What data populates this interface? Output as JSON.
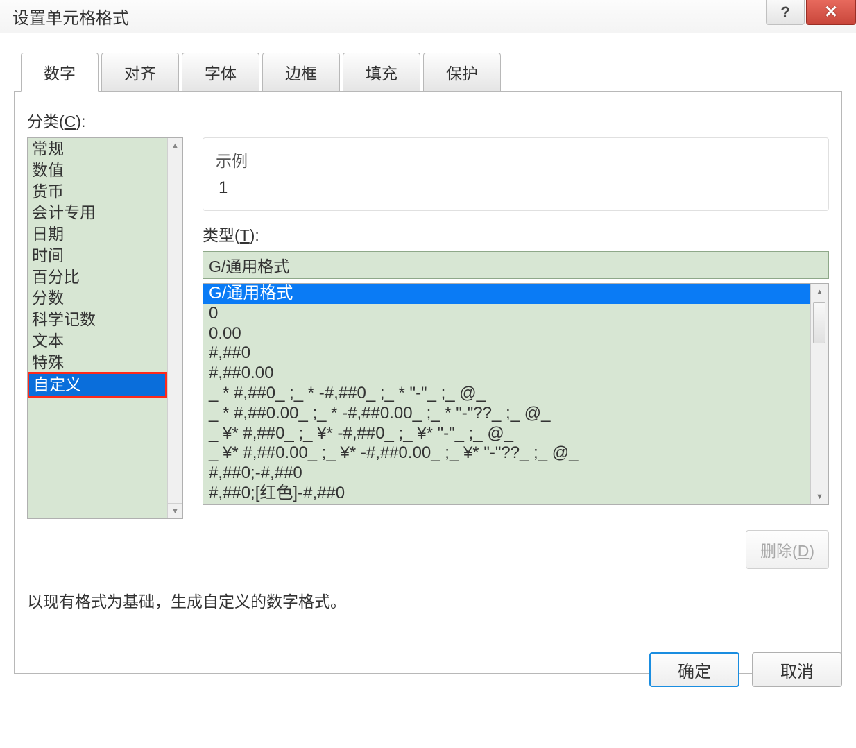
{
  "window": {
    "title": "设置单元格格式"
  },
  "tabs": [
    {
      "label": "数字",
      "active": true
    },
    {
      "label": "对齐",
      "active": false
    },
    {
      "label": "字体",
      "active": false
    },
    {
      "label": "边框",
      "active": false
    },
    {
      "label": "填充",
      "active": false
    },
    {
      "label": "保护",
      "active": false
    }
  ],
  "category": {
    "label_prefix": "分类(",
    "label_key": "C",
    "label_suffix": "):",
    "items": [
      "常规",
      "数值",
      "货币",
      "会计专用",
      "日期",
      "时间",
      "百分比",
      "分数",
      "科学记数",
      "文本",
      "特殊",
      "自定义"
    ],
    "selected_index": 11
  },
  "example": {
    "label": "示例",
    "value": "1"
  },
  "type": {
    "label_prefix": "类型(",
    "label_key": "T",
    "label_suffix": "):",
    "input_value": "G/通用格式",
    "items": [
      "G/通用格式",
      "0",
      "0.00",
      "#,##0",
      "#,##0.00",
      "_ * #,##0_ ;_ * -#,##0_ ;_ * \"-\"_ ;_ @_",
      "_ * #,##0.00_ ;_ * -#,##0.00_ ;_ * \"-\"??_ ;_ @_",
      "_ ¥* #,##0_ ;_ ¥* -#,##0_ ;_ ¥* \"-\"_ ;_ @_",
      "_ ¥* #,##0.00_ ;_ ¥* -#,##0.00_ ;_ ¥* \"-\"??_ ;_ @_",
      "#,##0;-#,##0",
      "#,##0;[红色]-#,##0"
    ],
    "selected_index": 0
  },
  "delete": {
    "label_prefix": "删除(",
    "label_key": "D",
    "label_suffix": ")"
  },
  "description": "以现有格式为基础，生成自定义的数字格式。",
  "footer": {
    "ok": "确定",
    "cancel": "取消"
  }
}
